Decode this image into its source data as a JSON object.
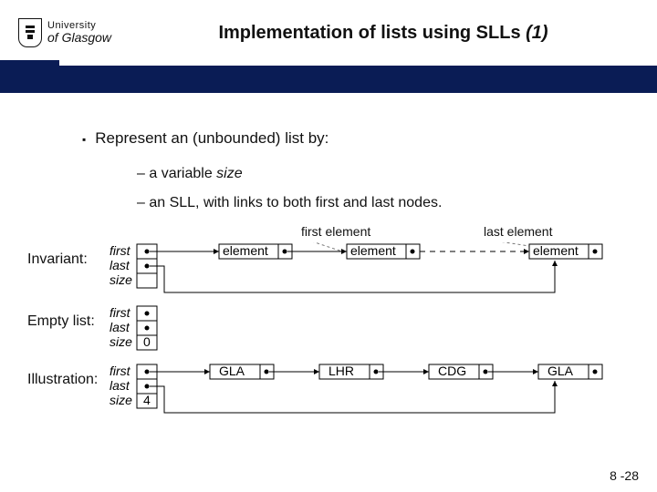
{
  "logo": {
    "line1": "University",
    "line2": "of Glasgow"
  },
  "title": {
    "main": "Implementation of lists using SLLs ",
    "tail": "(1)"
  },
  "bullets": {
    "main": "Represent an (unbounded) list by:",
    "sub1_pre": "a variable ",
    "sub1_it": "size",
    "sub2": "an SLL, with links to both first and last nodes."
  },
  "labels": {
    "first_elem": "first element",
    "last_elem": "last element"
  },
  "fields": {
    "first": "first",
    "last": "last",
    "size": "size"
  },
  "rows": {
    "invariant": {
      "label": "Invariant:",
      "cell": "element",
      "size_val": ""
    },
    "empty": {
      "label": "Empty list:",
      "size_val": "0"
    },
    "illustration": {
      "label": "Illustration:",
      "nodes": [
        "GLA",
        "LHR",
        "CDG",
        "GLA"
      ],
      "size_val": "4"
    }
  },
  "page": "8 -28"
}
